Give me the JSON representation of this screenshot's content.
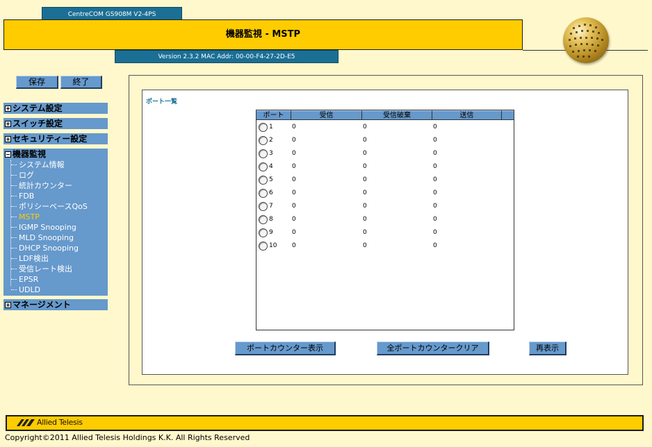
{
  "header": {
    "model": "CentreCOM GS908M V2-4PS",
    "title": "機器監視 - MSTP",
    "version": "Version 2.3.2 MAC Addr: 00-00-F4-27-2D-E5"
  },
  "sidebar": {
    "save_label": "保存",
    "exit_label": "終了",
    "menus": [
      {
        "label": "システム設定",
        "expanded": false
      },
      {
        "label": "スイッチ設定",
        "expanded": false
      },
      {
        "label": "セキュリティー設定",
        "expanded": false
      },
      {
        "label": "機器監視",
        "expanded": true
      },
      {
        "label": "マネージメント",
        "expanded": false
      }
    ],
    "monitor_items": [
      "システム情報",
      "ログ",
      "統計カウンター",
      "FDB",
      "ポリシーベースQoS",
      "MSTP",
      "IGMP Snooping",
      "MLD Snooping",
      "DHCP Snooping",
      "LDF検出",
      "受信レート検出",
      "EPSR",
      "UDLD"
    ],
    "active_item": "MSTP"
  },
  "main": {
    "section_title": "ポート一覧",
    "columns": [
      "ポート",
      "受信",
      "受信破棄",
      "送信"
    ],
    "rows": [
      {
        "port": "1",
        "rx": "0",
        "drop": "0",
        "tx": "0"
      },
      {
        "port": "2",
        "rx": "0",
        "drop": "0",
        "tx": "0"
      },
      {
        "port": "3",
        "rx": "0",
        "drop": "0",
        "tx": "0"
      },
      {
        "port": "4",
        "rx": "0",
        "drop": "0",
        "tx": "0"
      },
      {
        "port": "5",
        "rx": "0",
        "drop": "0",
        "tx": "0"
      },
      {
        "port": "6",
        "rx": "0",
        "drop": "0",
        "tx": "0"
      },
      {
        "port": "7",
        "rx": "0",
        "drop": "0",
        "tx": "0"
      },
      {
        "port": "8",
        "rx": "0",
        "drop": "0",
        "tx": "0"
      },
      {
        "port": "9",
        "rx": "0",
        "drop": "0",
        "tx": "0"
      },
      {
        "port": "10",
        "rx": "0",
        "drop": "0",
        "tx": "0"
      }
    ],
    "show_counter_label": "ポートカウンター表示",
    "clear_all_label": "全ポートカウンタークリア",
    "refresh_label": "再表示"
  },
  "footer": {
    "brand": "Allied Telesis",
    "copyright": "Copyright©2011 Allied Telesis Holdings K.K. All Rights Reserved"
  },
  "colors": {
    "accent_yellow": "#ffcc00",
    "nav_blue": "#6699cc",
    "header_blue": "#1b6f95",
    "background": "#fff8cc",
    "active_item": "#ffcc00"
  }
}
